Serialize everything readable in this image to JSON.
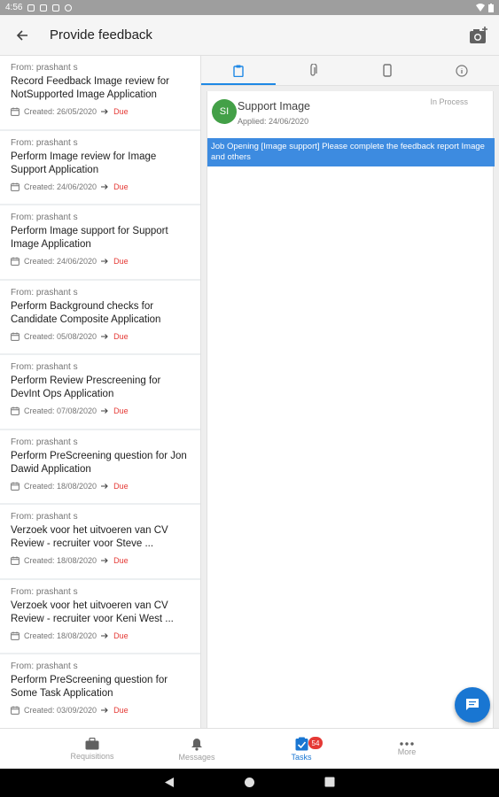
{
  "status_bar": {
    "time": "4:56"
  },
  "app_bar": {
    "title": "Provide feedback"
  },
  "tasks": [
    {
      "from": "From: prashant s",
      "title": "Record Feedback Image review for NotSupported Image Application",
      "created": "Created: 26/05/2020",
      "due": "Due"
    },
    {
      "from": "From: prashant s",
      "title": "Perform Image review for Image Support Application",
      "created": "Created: 24/06/2020",
      "due": "Due"
    },
    {
      "from": "From: prashant s",
      "title": "Perform Image support for Support Image Application",
      "created": "Created: 24/06/2020",
      "due": "Due"
    },
    {
      "from": "From: prashant s",
      "title": "Perform Background checks for Candidate Composite Application",
      "created": "Created: 05/08/2020",
      "due": "Due"
    },
    {
      "from": "From: prashant s",
      "title": "Perform Review Prescreening for DevInt Ops Application",
      "created": "Created: 07/08/2020",
      "due": "Due"
    },
    {
      "from": "From: prashant s",
      "title": "Perform PreScreening question for Jon Dawid Application",
      "created": "Created: 18/08/2020",
      "due": "Due"
    },
    {
      "from": "From: prashant s",
      "title": "Verzoek voor het uitvoeren van CV Review - recruiter voor Steve ...",
      "created": "Created: 18/08/2020",
      "due": "Due"
    },
    {
      "from": "From: prashant s",
      "title": "Verzoek voor het uitvoeren van CV Review - recruiter voor Keni West ...",
      "created": "Created: 18/08/2020",
      "due": "Due"
    },
    {
      "from": "From: prashant s",
      "title": "Perform PreScreening question for Some Task Application",
      "created": "Created: 03/09/2020",
      "due": "Due"
    }
  ],
  "detail": {
    "avatar_initials": "SI",
    "applicant_name": "Support Image",
    "applied": "Applied: 24/06/2020",
    "status": "In Process",
    "job_banner": "Job Opening [Image support] Please complete the feedback report Image and others"
  },
  "bottom_nav": {
    "requisitions": "Requisitions",
    "messages": "Messages",
    "tasks": "Tasks",
    "tasks_badge": "54",
    "more": "More"
  },
  "colors": {
    "accent": "#1976d2",
    "due": "#e53935",
    "avatar": "#43a047",
    "banner": "#3d8be0"
  }
}
